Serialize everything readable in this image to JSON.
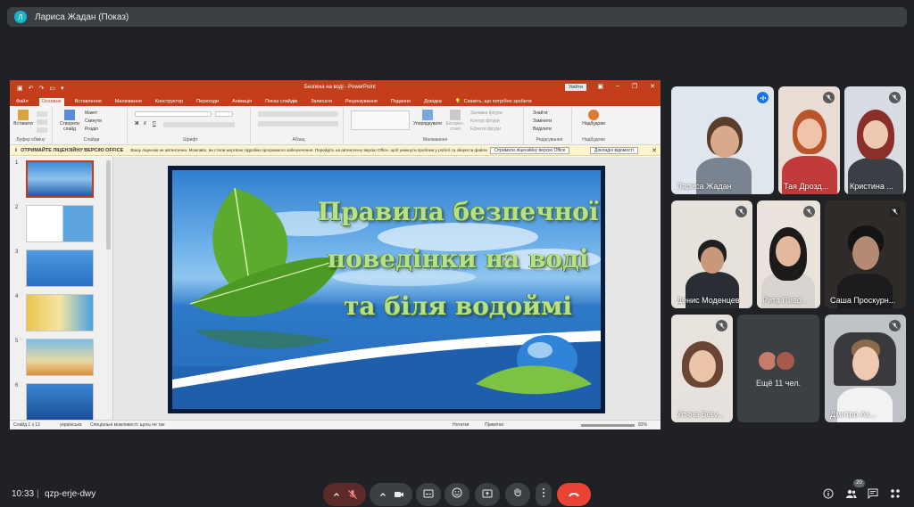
{
  "presenter": {
    "initial": "Л",
    "title": "Лариса Жадан (Показ)"
  },
  "powerpoint": {
    "document_title": "Безпека на воді  -  PowerPoint",
    "signin": "Увійти",
    "tabs": [
      "Файл",
      "Основне",
      "Вставлення",
      "Малювання",
      "Конструктор",
      "Переходи",
      "Анімація",
      "Показ слайдів",
      "Записати",
      "Рецензування",
      "Подання",
      "Довідка"
    ],
    "tell_me": "Скажіть, що потрібно зробити",
    "ribbon": {
      "paste": "Вставити",
      "clipboard": "Буфер обміну",
      "new_slide": "Створити слайд",
      "layout": "Макет",
      "reset": "Скинути",
      "section": "Розділ",
      "slides": "Слайди",
      "font": "Шрифт",
      "paragraph": "Абзац",
      "arrange": "Упорядкувати",
      "quick_styles": "Експрес-стилі",
      "shape_fill": "Заливка фігури",
      "shape_outline": "Контур фігури",
      "shape_effects": "Ефекти фігури",
      "drawing": "Малювання",
      "find": "Знайти",
      "replace": "Замінити",
      "select": "Виділити",
      "editing": "Редагування",
      "designer": "Надбудови",
      "addins": "Надбудови"
    },
    "message": {
      "title": "ОТРИМАЙТЕ ЛІЦЕНЗІЙНУ ВЕРСІЮ OFFICE",
      "text": "Вашу ліцензію не автентична. Можливо, ви стали жертвою підробки програмного забезпечення. Перейдіть на автентичну версію Office, щоб уникнути проблем у роботі та зберегти файли в безпеці.",
      "btn_get": "Отримати ліцензійну версію Office",
      "btn_more": "Докладні відомості"
    },
    "thumbnails": [
      "1",
      "2",
      "3",
      "4",
      "5",
      "6"
    ],
    "slide_title": "Правила безпечної поведінки на воді та біля водоймі",
    "slide_title_lines": [
      "Правила безпечної",
      "поведінки на воді",
      "та біля водоймі"
    ],
    "status": {
      "slide": "Слайд 1 з 13",
      "lang": "українська",
      "accessibility": "Спеціальні можливості: щось не так",
      "notes": "Нотатки",
      "comments": "Примітки",
      "zoom": "82%"
    }
  },
  "participants": [
    {
      "name": "Лариса Жадан",
      "speaking": true
    },
    {
      "name": "Тая Дрозд...",
      "muted": true
    },
    {
      "name": "Кристина ...",
      "muted": true
    },
    {
      "name": "Денис Моденцев",
      "muted": true
    },
    {
      "name": "Рита Пиво...",
      "muted": true
    },
    {
      "name": "Саша Проскурн...",
      "muted": true
    },
    {
      "name": "Уляна Бегу...",
      "muted": true
    },
    {
      "name": "Дмитро Ах...",
      "muted": true
    }
  ],
  "more_participants": "Ещё 11 чел.",
  "meeting": {
    "time": "10:33",
    "separator": "|",
    "code": "qzp-erje-dwy",
    "participant_count": "20"
  }
}
